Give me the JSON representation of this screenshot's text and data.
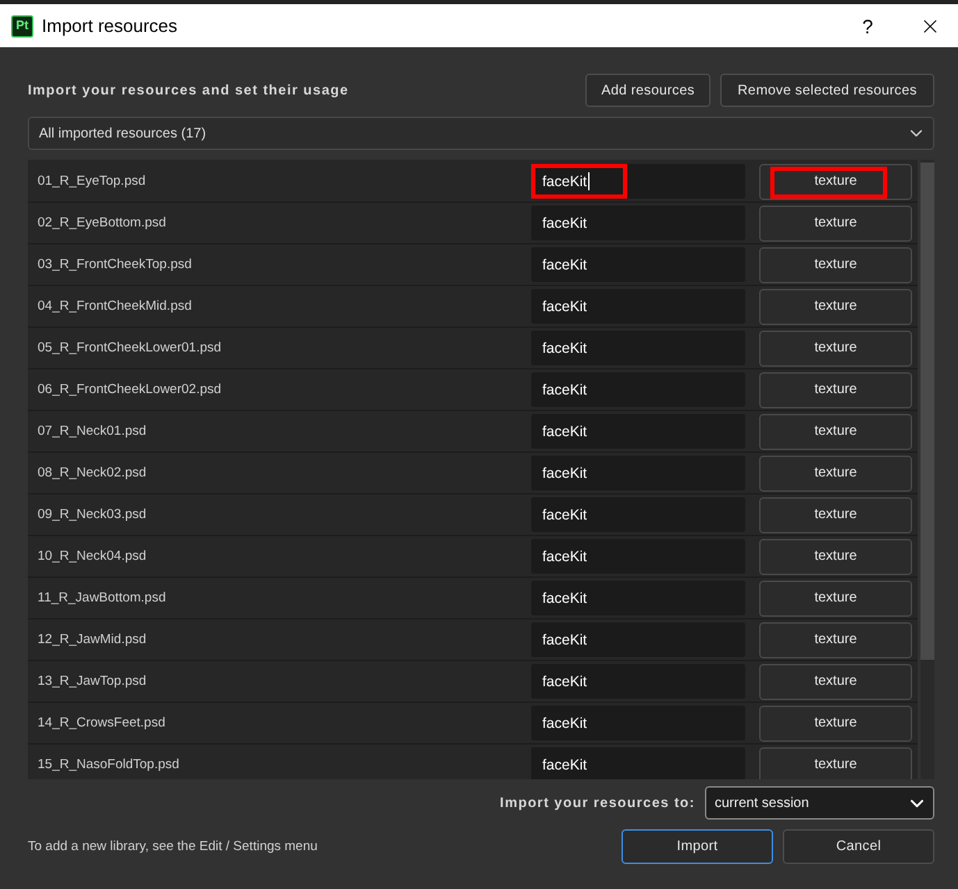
{
  "window": {
    "app_icon": "Pt",
    "title": "Import resources",
    "help": "?"
  },
  "header": {
    "heading": "Import your resources and set their usage",
    "buttons": [
      "Add resources",
      "Remove selected resources"
    ]
  },
  "filter": {
    "value": "All imported resources (17)"
  },
  "resources": [
    {
      "file": "01_R_EyeTop.psd",
      "library": "faceKit",
      "usage": "texture",
      "focused": true,
      "highlighted": true
    },
    {
      "file": "02_R_EyeBottom.psd",
      "library": "faceKit",
      "usage": "texture",
      "focused": false,
      "highlighted": false
    },
    {
      "file": "03_R_FrontCheekTop.psd",
      "library": "faceKit",
      "usage": "texture",
      "focused": false,
      "highlighted": false
    },
    {
      "file": "04_R_FrontCheekMid.psd",
      "library": "faceKit",
      "usage": "texture",
      "focused": false,
      "highlighted": false
    },
    {
      "file": "05_R_FrontCheekLower01.psd",
      "library": "faceKit",
      "usage": "texture",
      "focused": false,
      "highlighted": false
    },
    {
      "file": "06_R_FrontCheekLower02.psd",
      "library": "faceKit",
      "usage": "texture",
      "focused": false,
      "highlighted": false
    },
    {
      "file": "07_R_Neck01.psd",
      "library": "faceKit",
      "usage": "texture",
      "focused": false,
      "highlighted": false
    },
    {
      "file": "08_R_Neck02.psd",
      "library": "faceKit",
      "usage": "texture",
      "focused": false,
      "highlighted": false
    },
    {
      "file": "09_R_Neck03.psd",
      "library": "faceKit",
      "usage": "texture",
      "focused": false,
      "highlighted": false
    },
    {
      "file": "10_R_Neck04.psd",
      "library": "faceKit",
      "usage": "texture",
      "focused": false,
      "highlighted": false
    },
    {
      "file": "11_R_JawBottom.psd",
      "library": "faceKit",
      "usage": "texture",
      "focused": false,
      "highlighted": false
    },
    {
      "file": "12_R_JawMid.psd",
      "library": "faceKit",
      "usage": "texture",
      "focused": false,
      "highlighted": false
    },
    {
      "file": "13_R_JawTop.psd",
      "library": "faceKit",
      "usage": "texture",
      "focused": false,
      "highlighted": false
    },
    {
      "file": "14_R_CrowsFeet.psd",
      "library": "faceKit",
      "usage": "texture",
      "focused": false,
      "highlighted": false
    },
    {
      "file": "15_R_NasoFoldTop.psd",
      "library": "faceKit",
      "usage": "texture",
      "focused": false,
      "highlighted": false
    }
  ],
  "footer": {
    "destination_label": "Import your resources to:",
    "destination": "current session",
    "hint": "To add a new library, see the Edit / Settings menu",
    "buttons": [
      {
        "label": "Import",
        "default": true
      },
      {
        "label": "Cancel",
        "default": false
      }
    ]
  }
}
